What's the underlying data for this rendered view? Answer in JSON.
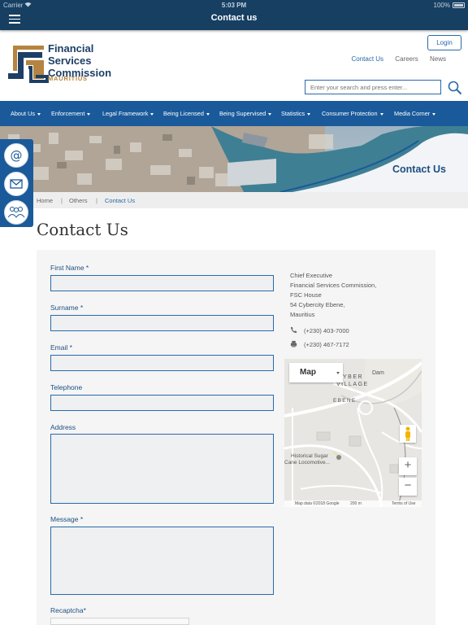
{
  "status_bar": {
    "carrier": "Carrier",
    "time": "5:03 PM",
    "battery": "100%"
  },
  "app_bar": {
    "title": "Contact us",
    "menu_icon": "hamburger-menu-icon"
  },
  "header": {
    "logo_line1": "Financial",
    "logo_line2": "Services",
    "logo_line3": "Commission",
    "logo_sub": "MAURITIUS",
    "login_label": "Login",
    "links": [
      "Contact Us",
      "Careers",
      "News"
    ],
    "search_placeholder": "Enter your search and press enter..."
  },
  "nav": {
    "items": [
      "About Us",
      "Enforcement",
      "Legal Framework",
      "Being Licensed",
      "Being Supervised",
      "Statistics",
      "Consumer Protection",
      "Media Corner"
    ]
  },
  "banner": {
    "title": "Contact Us"
  },
  "side_icons": [
    "at-icon",
    "mail-icon",
    "people-icon"
  ],
  "breadcrumb": {
    "items": [
      "Home",
      "Others",
      "Contact Us"
    ]
  },
  "page": {
    "title": "Contact Us"
  },
  "form": {
    "first_name": "First Name *",
    "surname": "Surname *",
    "email": "Email *",
    "telephone": "Telephone",
    "address": "Address",
    "message": "Message *",
    "recaptcha": "Recaptcha*"
  },
  "contact": {
    "lines": [
      "Chief Executive",
      "Financial Services Commission,",
      "FSC House",
      "54 Cybercity Ebene,",
      "Mauritius"
    ],
    "phone": "(+230) 403-7000",
    "fax": "(+230) 467-7172"
  },
  "map": {
    "type_label": "Map",
    "zoom_in": "+",
    "zoom_out": "−",
    "labels": {
      "dam": "Dam",
      "cyber": "YBER",
      "village": "VILLAGE",
      "ebene": "EBENE",
      "poi_line1": "Historical Sugar",
      "poi_line2": "Cane Locomotive..."
    },
    "footer_data": "Map data ©2018 Google",
    "footer_scale": "200 m",
    "footer_terms": "Terms of Use"
  }
}
